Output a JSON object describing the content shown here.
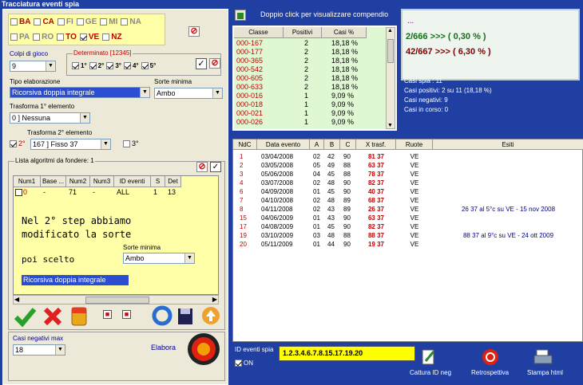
{
  "window_title": "Tracciatura eventi spia",
  "wheels_row1": [
    {
      "label": "BA",
      "checked": false,
      "active": true
    },
    {
      "label": "CA",
      "checked": false,
      "active": true
    },
    {
      "label": "FI",
      "checked": false,
      "active": false
    },
    {
      "label": "GE",
      "checked": false,
      "active": false
    },
    {
      "label": "MI",
      "checked": false,
      "active": false
    },
    {
      "label": "NA",
      "checked": false,
      "active": false
    }
  ],
  "wheels_row2": [
    {
      "label": "PA",
      "checked": false,
      "active": false
    },
    {
      "label": "RO",
      "checked": false,
      "active": false
    },
    {
      "label": "TO",
      "checked": false,
      "active": true
    },
    {
      "label": "VE",
      "checked": true,
      "active": true
    },
    {
      "label": "NZ",
      "checked": false,
      "active": true
    }
  ],
  "colpi_label": "Colpi di gioco",
  "colpi_value": "9",
  "determinato_label": "Determinato [12345]",
  "determinato_items": [
    "1°",
    "2°",
    "3°",
    "4°",
    "5°"
  ],
  "tipo_label": "Tipo elaborazione",
  "tipo_value": "Ricorsiva doppia integrale",
  "sorte_label": "Sorte minima",
  "sorte_value": "Ambo",
  "trasforma1_label": "Trasforma 1° elemento",
  "trasforma1_value": "0 ] Nessuna",
  "trasforma2_label": "Trasforma 2° elemento",
  "trasforma2_check": "2°",
  "trasforma2_value": "167 ] Fisso 37",
  "terzo_label": "3°",
  "lista_label": "Lista algoritmi da fondere: 1",
  "lista_headers": [
    "Num1",
    "Base ...",
    "Num2",
    "Num3",
    "ID eventi",
    "S",
    "Det"
  ],
  "lista_row": [
    "0",
    "-",
    "71",
    "-",
    "ALL",
    "1",
    "13"
  ],
  "overlay_line1": "Nel 2° step abbiamo",
  "overlay_line2": "modificato la sorte",
  "overlay_line3": "poi scelto",
  "overlay_sorte_label": "Sorte minima",
  "overlay_sorte_value": "Ambo",
  "overlay_tipo_value": "Ricorsiva doppia integrale",
  "casi_neg_label": "Casi negativi max",
  "casi_neg_value": "18",
  "elabora_label": "Elabora",
  "doppio_click": "Doppio click per visualizzare compendio",
  "green_headers": [
    "Classe",
    "Positivi",
    "Casi %"
  ],
  "green_rows": [
    [
      "000-167",
      "2",
      "18,18 %"
    ],
    [
      "000-177",
      "2",
      "18,18 %"
    ],
    [
      "000-365",
      "2",
      "18,18 %"
    ],
    [
      "000-542",
      "2",
      "18,18 %"
    ],
    [
      "000-605",
      "2",
      "18,18 %"
    ],
    [
      "000-633",
      "2",
      "18,18 %"
    ],
    [
      "000-016",
      "1",
      "9,09 %"
    ],
    [
      "000-018",
      "1",
      "9,09 %"
    ],
    [
      "000-021",
      "1",
      "9,09 %"
    ],
    [
      "000-026",
      "1",
      "9,09 %"
    ]
  ],
  "info_dots": "...",
  "info_line1": "2/666 >>> ( 0,30 % )",
  "info_line2": "42/667 >>> ( 6,30 % )",
  "stats": [
    "Casi spia : 11",
    "Casi positivi: 2 su 11 (18,18 %)",
    "Casi negativi: 9",
    "Casi in corso: 0"
  ],
  "main_headers": [
    "NdC",
    "Data evento",
    "A",
    "B",
    "C",
    "X trasf.",
    "Ruote",
    "Esiti"
  ],
  "main_rows": [
    [
      "1",
      "03/04/2008",
      "02",
      "42",
      "90",
      "81 37",
      "VE",
      ""
    ],
    [
      "2",
      "03/05/2008",
      "05",
      "49",
      "88",
      "63 37",
      "VE",
      ""
    ],
    [
      "3",
      "05/06/2008",
      "04",
      "45",
      "88",
      "78 37",
      "VE",
      ""
    ],
    [
      "4",
      "03/07/2008",
      "02",
      "48",
      "90",
      "82 37",
      "VE",
      ""
    ],
    [
      "6",
      "04/09/2008",
      "01",
      "45",
      "90",
      "40 37",
      "VE",
      ""
    ],
    [
      "7",
      "04/10/2008",
      "02",
      "48",
      "89",
      "68 37",
      "VE",
      ""
    ],
    [
      "8",
      "04/11/2008",
      "02",
      "43",
      "89",
      "26 37",
      "VE",
      "26 37 al 5°c su VE - 15 nov 2008"
    ],
    [
      "15",
      "04/06/2009",
      "01",
      "43",
      "90",
      "63 37",
      "VE",
      ""
    ],
    [
      "17",
      "04/08/2009",
      "01",
      "45",
      "90",
      "82 37",
      "VE",
      ""
    ],
    [
      "19",
      "03/10/2009",
      "03",
      "48",
      "88",
      "88 37",
      "VE",
      "88 37 al 9°c su VE - 24 ott 2009"
    ],
    [
      "20",
      "05/11/2009",
      "01",
      "44",
      "90",
      "19 37",
      "VE",
      ""
    ]
  ],
  "id_eventi_label": "ID eventi spia",
  "id_eventi_value": "1.2.3.4.6.7.8.15.17.19.20",
  "on_label": "ON",
  "btn_cattura": "Cattura ID neg",
  "btn_retro": "Retrospettiva",
  "btn_stampa": "Stampa html"
}
